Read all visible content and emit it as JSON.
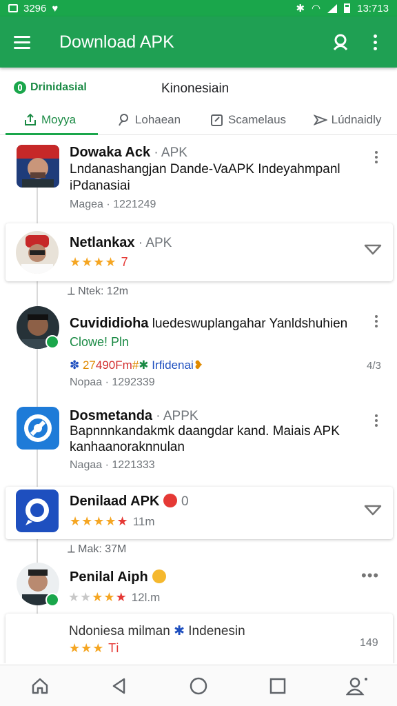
{
  "status_bar": {
    "left_text": "3296",
    "time": "13:713"
  },
  "app_bar": {
    "title": "Download APK"
  },
  "brand": {
    "label": "Drinidasial"
  },
  "section_title": "Kinonesiain",
  "tabs": [
    {
      "label": "Moyya",
      "icon": "share-icon",
      "active": true
    },
    {
      "label": "Lohaean",
      "icon": "link-icon",
      "active": false
    },
    {
      "label": "Scamelaus",
      "icon": "edit-square-icon",
      "active": false
    },
    {
      "label": "Lúdnaidly",
      "icon": "send-icon",
      "active": false
    }
  ],
  "items": [
    {
      "name": "Dowaka Ack",
      "tag": " · APK",
      "desc_line1": "Lndanashangjan Dande-VaAPK  Indeyahmpanl",
      "desc_line2": "iPdanasiai",
      "meta": "Magea · 1221249"
    },
    {
      "name": "Netlankax",
      "tag": " · APK",
      "stars": "★★★★",
      "stars_note": "7",
      "pin_meta": "Ntek: 12m"
    },
    {
      "name": "Cuvididioha",
      "desc_inline": " luedeswuplangahar Yanldshuhien",
      "green": "Clowe! Pln",
      "mixed": [
        "✽ ",
        "27",
        "490Fm",
        "#",
        "✱ ",
        "Irfidenai",
        "❥"
      ],
      "side_num": "4/3",
      "meta": "Nopaa · 1292339"
    },
    {
      "name": "Dosmetanda",
      "tag": " · APPK",
      "desc_line1": "Bapnnnkandakmk daangdar kand. Maiais APK",
      "desc_line2": "kanhaanoraknnulan",
      "meta": "Nagaa · 1221333"
    },
    {
      "name": "Denilaad APK",
      "tag": "0",
      "stars": "★★★★",
      "stars_red": "★",
      "stars_note": "11m",
      "pin_meta": "Mak: 37M"
    },
    {
      "name": "Penilal Aiph",
      "stars_grey": "★★",
      "stars": "★★",
      "stars_red": "★",
      "stars_note": "12l.m"
    },
    {
      "desc_line1": "Ndoniesa milman",
      "desc_tail": "Indenesin",
      "stars": "★★★",
      "stars_red": "Ti",
      "side_num": "149"
    }
  ],
  "colors": {
    "brand_green": "#1fa053",
    "star": "#f5a623",
    "star_red": "#e53935"
  }
}
